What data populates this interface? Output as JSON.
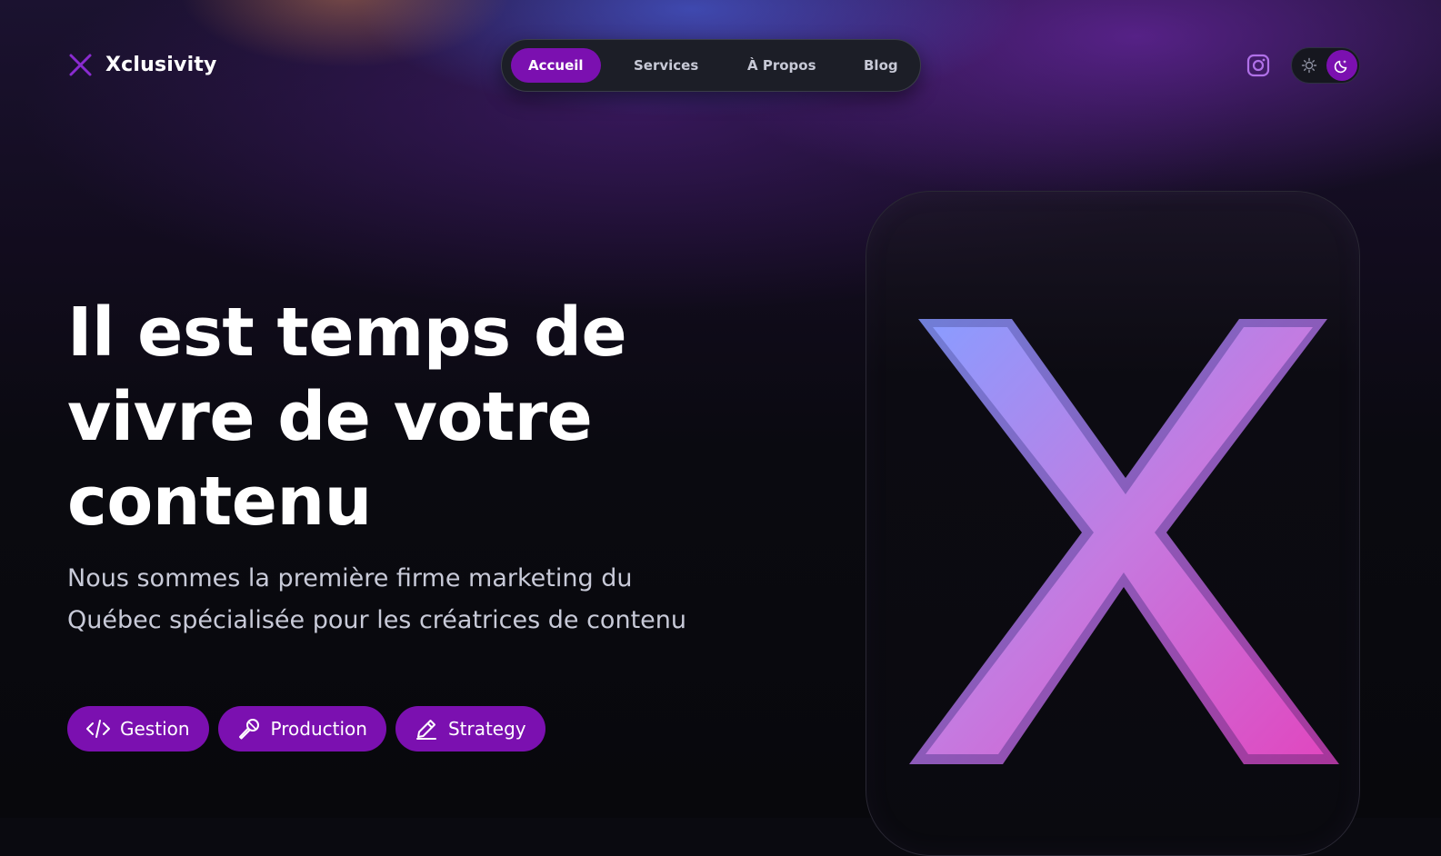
{
  "brand": {
    "name": "Xclusivity",
    "logo_icon": "x-icon"
  },
  "nav": {
    "items": [
      {
        "label": "Accueil",
        "active": true
      },
      {
        "label": "Services",
        "active": false
      },
      {
        "label": "À Propos",
        "active": false
      },
      {
        "label": "Blog",
        "active": false
      }
    ]
  },
  "header": {
    "social_icon": "instagram-icon",
    "theme_toggle": {
      "options": [
        "sun-icon",
        "moon-icon"
      ],
      "selected": "moon-icon"
    }
  },
  "hero": {
    "title_lines": [
      "Il est temps de",
      "vivre de votre",
      "contenu"
    ],
    "subtitle": "Nous sommes la première firme marketing du Québec spécialisée pour les créatrices de contenu",
    "chips": [
      {
        "label": "Gestion",
        "icon": "code-icon"
      },
      {
        "label": "Production",
        "icon": "microphone-icon"
      },
      {
        "label": "Strategy",
        "icon": "pencil-icon"
      }
    ]
  },
  "colors": {
    "accent": "#7b10b0",
    "background": "#0a0a10",
    "x_gradient_start": "#8a9cff",
    "x_gradient_end": "#e048c0"
  }
}
